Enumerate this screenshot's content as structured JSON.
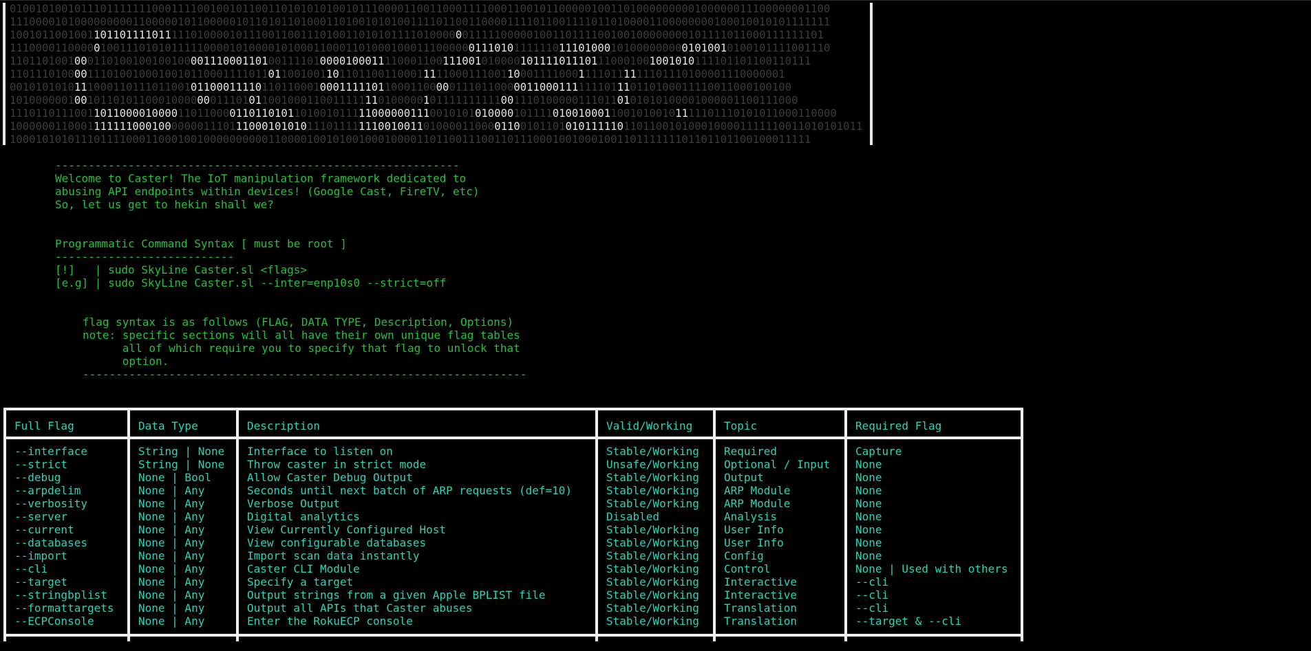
{
  "banner": {
    "lines": [
      "0100101001011101111111000111100100101100110101010100101110000110011000111100011001011000001001101000000000100000011100000001100",
      "1110000101000000000110000010110000010110101101000110100101010011110110011000011110110011110110100001100000000100010010101111111",
      "1001011001001[101101111011]11101000010111001100111010011010101111010000[0]01111100000100110111100100100000000101111011000111111101",
      "1110000110000[0]100111010101111100001010000101000110001101000100011100000[0111010]1111110[11101000]10100000000[0101001]0100101111001110",
      "1101101001[00]0110100100100100[001110001101]00111101[0000100011]110001100[111001]010000[101111011101]11000100[1001010]111101101100110111",
      "1101110100[00]1110100100010010110001111011[01]1001001[10]1101100110001[11]11000111001[10]001111000[1]111011[11]11101110100001110000001",
      "0010101010[11]1000110111011001[01100011110]110110001[0001111101]10001100[00]0111011000[0011000111]111101[11]0110100011110011000100100",
      "1010000001[00]10110101100010000[00]011101[01]1001000110011111[11]0100000[1]01111111111[00]1110100000111011[01]01010100001000001100111000",
      "1110110111001[1011000010000]11011000[0110110101]1010010111[11000000111]0010101[010000]101111[010010001]1001010010[11]11101110101011000110000",
      "1000000110001[111111000100]0000011101[11000101010]11101111[1110010011]01000011000[0110]0101101[010111110]1101100101000100001111110011010101011",
      "1000101010111011110001100010010000000000110000100101001000100001101100111001101110001001000100110111111101101101100100011111"
    ]
  },
  "intro": {
    "rule": "-------------------------------------------------------------",
    "lines": [
      "Welcome to Caster! The IoT manipulation framework dedicated to",
      "abusing API endpoints within devices! (Google Cast, FireTV, etc)",
      "So, let us get to hekin shall we?"
    ]
  },
  "syntax": {
    "title": "Programmatic Command Syntax [ must be root ]",
    "rule": "---------------------------",
    "line1": "[!]   | sudo SkyLine Caster.sl <flags>",
    "line2": "[e.g] | sudo SkyLine Caster.sl --inter=enp10s0 --strict=off"
  },
  "flagnote": {
    "line1": "flag syntax is as follows (FLAG, DATA TYPE, Description, Options)",
    "line2": "note: specific sections will all have their own unique flag tables",
    "line3": "      all of which require you to specify that flag to unlock that",
    "line4": "      option.",
    "rule": "-------------------------------------------------------------------"
  },
  "table": {
    "headers": [
      "Full Flag",
      "Data Type",
      "Description",
      "Valid/Working",
      "Topic",
      "Required Flag"
    ],
    "columns": [
      [
        "--interface",
        "--strict",
        "--debug",
        "--arpdelim",
        "--verbosity",
        "--server",
        "--current",
        "--databases",
        "--import",
        "--cli",
        "--target",
        "--stringbplist",
        "--formattargets",
        "--ECPConsole"
      ],
      [
        "String | None",
        "String | None",
        "None | Bool",
        "None | Any",
        "None | Any",
        "None | Any",
        "None | Any",
        "None | Any",
        "None | Any",
        "None | Any",
        "None | Any",
        "None | Any",
        "None | Any",
        "None | Any"
      ],
      [
        "Interface to listen on",
        "Throw caster in strict mode",
        "Allow Caster Debug Output",
        "Seconds until next batch of ARP requests (def=10)",
        "Verbose Output",
        "Digital analytics",
        "View Currently Configured Host",
        "View configurable databases",
        "Import scan data instantly",
        "Caster CLI Module",
        "Specify a target",
        "Output strings from a given Apple BPLIST file",
        "Output all APIs that Caster abuses",
        "Enter the RokuECP console"
      ],
      [
        "Stable/Working",
        "Unsafe/Working",
        "Stable/Working",
        "Stable/Working",
        "Stable/Working",
        "Disabled",
        "Stable/Working",
        "Stable/Working",
        "Stable/Working",
        "Stable/Working",
        "Stable/Working",
        "Stable/Working",
        "Stable/Working",
        "Stable/Working"
      ],
      [
        "Required",
        "Optional / Input",
        "Output",
        "ARP Module",
        "ARP Module",
        "Analysis",
        "User Info",
        "User Info",
        "Config",
        "Control",
        "Interactive",
        "Interactive",
        "Translation",
        "Translation"
      ],
      [
        "Capture",
        "None",
        "None",
        "None",
        "None",
        "None",
        "None",
        "None",
        "None",
        "None | Used with others",
        "--cli",
        "--cli",
        "--cli",
        "--target & --cli"
      ]
    ]
  },
  "colors": {
    "text_green": "#25c13a",
    "table_teal": "#2ed3b5",
    "border": "#f0f0f0",
    "background": "#000000"
  }
}
